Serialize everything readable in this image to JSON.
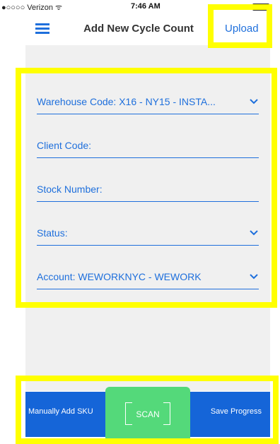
{
  "status_bar": {
    "carrier": "●○○○○ Verizon ᯤ",
    "time": "7:46 AM"
  },
  "nav": {
    "title": "Add New Cycle Count",
    "upload_label": "Upload"
  },
  "form": {
    "fields": [
      {
        "label": "Warehouse Code: X16 - NY15 - INSTA...",
        "dropdown": true
      },
      {
        "label": "Client Code:",
        "dropdown": false
      },
      {
        "label": "Stock Number:",
        "dropdown": false
      },
      {
        "label": "Status:",
        "dropdown": true
      },
      {
        "label": "Account: WEWORKNYC - WEWORK",
        "dropdown": true
      }
    ]
  },
  "bottom_bar": {
    "manual_label": "Manually Add SKU",
    "scan_label": "SCAN",
    "save_label": "Save Progress"
  },
  "colors": {
    "accent": "#1e6fdc",
    "bottom_bar": "#1565d8",
    "scan_button": "#54d97a",
    "highlight": "#ffff00",
    "content_background": "#f0f0f0"
  }
}
